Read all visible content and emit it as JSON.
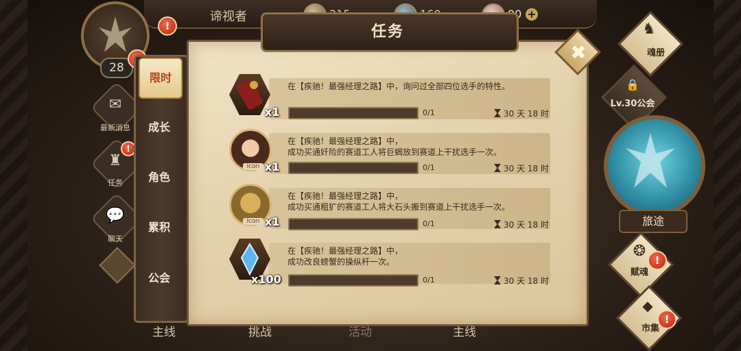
{
  "header": {
    "player_name": "谛视者",
    "resources": [
      {
        "icon": "coin-icon",
        "value": "215"
      },
      {
        "icon": "gem-icon",
        "value": "160"
      },
      {
        "icon": "stamina-icon",
        "value": "90"
      }
    ],
    "add_symbol": "+"
  },
  "player": {
    "level": "28",
    "alert": "!"
  },
  "left_menu": [
    {
      "label": "最新消息",
      "icon": "news-icon"
    },
    {
      "label": "任务",
      "icon": "quest-icon"
    },
    {
      "label": "聊天",
      "icon": "chat-icon"
    }
  ],
  "panel": {
    "title": "任务",
    "close_symbol": "✖",
    "tabs": [
      "限时",
      "成长",
      "角色",
      "累积",
      "公会"
    ],
    "active_tab": "限时"
  },
  "quests": [
    {
      "reward_icon": "token-scroll-icon",
      "qty": "x1",
      "icon_label": "",
      "line1": "在【疾驰！最强经理之路】中，询问过全部四位选手的特性。",
      "line2": "",
      "progress": "0/1",
      "progress_fraction": 0,
      "time": "30 天 18 时"
    },
    {
      "reward_icon": "girl-portrait-icon",
      "qty": "x1",
      "icon_label": "Icon",
      "line1": "在【疾驰！最强经理之路】中，",
      "line2": "成功买通奸险的赛道工人将巨蝎放到赛道上干扰选手一次。",
      "progress": "0/1",
      "progress_fraction": 0,
      "time": "30 天 18 时"
    },
    {
      "reward_icon": "beast-portrait-icon",
      "qty": "x1",
      "icon_label": "Icon",
      "line1": "在【疾驰！最强经理之路】中，",
      "line2": "成功买通粗犷的赛道工人将大石头搬到赛道上干扰选手一次。",
      "progress": "0/1",
      "progress_fraction": 0,
      "time": "30 天 18 时"
    },
    {
      "reward_icon": "blue-crystal-icon",
      "qty": "x100",
      "icon_label": "",
      "line1": "在【疾驰！最强经理之路】中，",
      "line2": "成功改良螃蟹的操纵杆一次。",
      "progress": "0/1",
      "progress_fraction": 0,
      "time": "30 天 18 时"
    }
  ],
  "right_menu": {
    "soulbook": "魂册",
    "guild_locked": "Lv.30",
    "guild": "公会",
    "journey": "旅途",
    "fusion": "赋魂",
    "market": "市集"
  },
  "bottom_nav": [
    "主线",
    "挑战",
    "活动",
    "主线"
  ]
}
